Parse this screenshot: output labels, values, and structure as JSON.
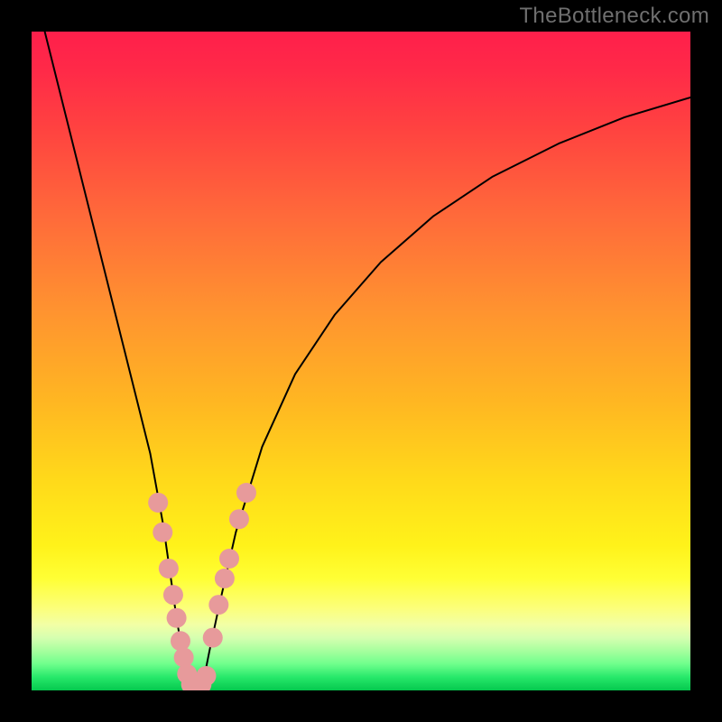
{
  "watermark": "TheBottleneck.com",
  "chart_data": {
    "type": "line",
    "title": "",
    "xlabel": "",
    "ylabel": "",
    "xlim": [
      0,
      100
    ],
    "ylim": [
      0,
      100
    ],
    "grid": false,
    "legend": false,
    "gradient_stops": [
      {
        "pos": 0,
        "color": "#ff1f4b"
      },
      {
        "pos": 0.15,
        "color": "#ff4340"
      },
      {
        "pos": 0.42,
        "color": "#ff9230"
      },
      {
        "pos": 0.68,
        "color": "#ffd91a"
      },
      {
        "pos": 0.83,
        "color": "#ffff35"
      },
      {
        "pos": 0.94,
        "color": "#a6ff9e"
      },
      {
        "pos": 1.0,
        "color": "#05c84e"
      }
    ],
    "series": [
      {
        "name": "bottleneck-curve",
        "color": "#000000",
        "stroke_width": 2.0,
        "x": [
          2.0,
          4.0,
          6.0,
          8.0,
          10.0,
          12.0,
          14.0,
          16.0,
          18.0,
          20.0,
          21.0,
          22.0,
          23.0,
          23.7,
          24.5,
          25.5,
          26.2,
          27.0,
          28.5,
          31.0,
          35.0,
          40.0,
          46.0,
          53.0,
          61.0,
          70.0,
          80.0,
          90.0,
          100.0
        ],
        "y": [
          100,
          92,
          84,
          76,
          68,
          60,
          52,
          44,
          36,
          25,
          18,
          11,
          5,
          2,
          0.5,
          0.5,
          2,
          6,
          13,
          24,
          37,
          48,
          57,
          65,
          72,
          78,
          83,
          87,
          90
        ]
      }
    ],
    "markers": [
      {
        "name": "left-branch-dots",
        "color": "#e79a9b",
        "radius": 11,
        "points": [
          {
            "x": 19.2,
            "y": 28.5
          },
          {
            "x": 19.9,
            "y": 24.0
          },
          {
            "x": 20.8,
            "y": 18.5
          },
          {
            "x": 21.5,
            "y": 14.5
          },
          {
            "x": 22.0,
            "y": 11.0
          },
          {
            "x": 22.6,
            "y": 7.5
          },
          {
            "x": 23.1,
            "y": 5.0
          },
          {
            "x": 23.6,
            "y": 2.5
          }
        ]
      },
      {
        "name": "bottom-dots",
        "color": "#e79a9b",
        "radius": 11,
        "points": [
          {
            "x": 24.2,
            "y": 0.9
          },
          {
            "x": 25.0,
            "y": 0.6
          },
          {
            "x": 25.8,
            "y": 0.9
          },
          {
            "x": 26.5,
            "y": 2.2
          }
        ]
      },
      {
        "name": "right-branch-dots",
        "color": "#e79a9b",
        "radius": 11,
        "points": [
          {
            "x": 27.5,
            "y": 8.0
          },
          {
            "x": 28.4,
            "y": 13.0
          },
          {
            "x": 29.3,
            "y": 17.0
          },
          {
            "x": 30.0,
            "y": 20.0
          },
          {
            "x": 31.5,
            "y": 26.0
          },
          {
            "x": 32.6,
            "y": 30.0
          }
        ]
      }
    ],
    "curve_minimum": {
      "x": 25.0,
      "y": 0.5
    }
  }
}
